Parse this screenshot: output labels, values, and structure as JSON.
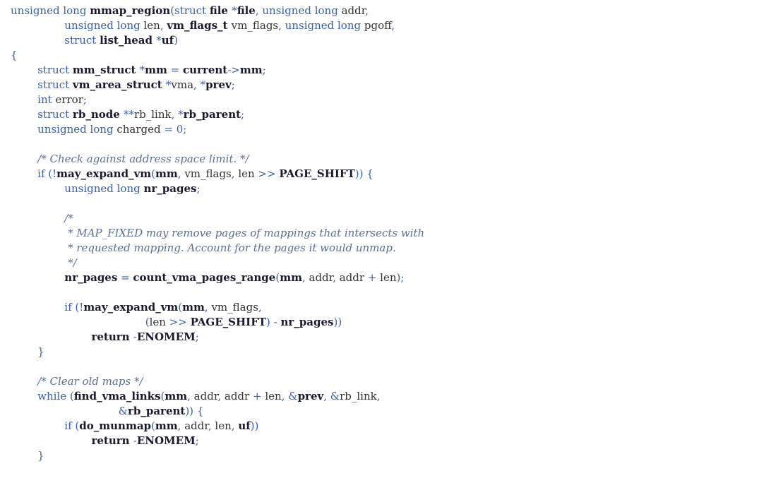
{
  "code": {
    "lines": [
      [
        [
          "kw",
          "unsigned long "
        ],
        [
          "fn",
          "mmap_region"
        ],
        [
          "op",
          "("
        ],
        [
          "kw",
          "struct "
        ],
        [
          "ty",
          "file "
        ],
        [
          "op",
          "*"
        ],
        [
          "fn",
          "file"
        ],
        [
          "op",
          ", "
        ],
        [
          "kw",
          "unsigned long "
        ],
        [
          "pl",
          "addr"
        ],
        [
          "op",
          ","
        ]
      ],
      [
        [
          "pl",
          "                "
        ],
        [
          "kw",
          "unsigned long "
        ],
        [
          "pl",
          "len"
        ],
        [
          "op",
          ", "
        ],
        [
          "ty",
          "vm_flags_t "
        ],
        [
          "pl",
          "vm_flags"
        ],
        [
          "op",
          ", "
        ],
        [
          "kw",
          "unsigned long "
        ],
        [
          "pl",
          "pgoff"
        ],
        [
          "op",
          ","
        ]
      ],
      [
        [
          "pl",
          "                "
        ],
        [
          "kw",
          "struct "
        ],
        [
          "ty",
          "list_head "
        ],
        [
          "op",
          "*"
        ],
        [
          "fn",
          "uf"
        ],
        [
          "op",
          ")"
        ]
      ],
      [
        [
          "op",
          "{"
        ]
      ],
      [
        [
          "pl",
          "        "
        ],
        [
          "kw",
          "struct "
        ],
        [
          "ty",
          "mm_struct "
        ],
        [
          "op",
          "*"
        ],
        [
          "fn",
          "mm"
        ],
        [
          "op",
          " = "
        ],
        [
          "fn",
          "current"
        ],
        [
          "op",
          "->"
        ],
        [
          "fn",
          "mm"
        ],
        [
          "op",
          ";"
        ]
      ],
      [
        [
          "pl",
          "        "
        ],
        [
          "kw",
          "struct "
        ],
        [
          "ty",
          "vm_area_struct "
        ],
        [
          "op",
          "*"
        ],
        [
          "pl",
          "vma"
        ],
        [
          "op",
          ", *"
        ],
        [
          "fn",
          "prev"
        ],
        [
          "op",
          ";"
        ]
      ],
      [
        [
          "pl",
          "        "
        ],
        [
          "kw",
          "int "
        ],
        [
          "pl",
          "error"
        ],
        [
          "op",
          ";"
        ]
      ],
      [
        [
          "pl",
          "        "
        ],
        [
          "kw",
          "struct "
        ],
        [
          "ty",
          "rb_node "
        ],
        [
          "op",
          "**"
        ],
        [
          "pl",
          "rb_link"
        ],
        [
          "op",
          ", *"
        ],
        [
          "fn",
          "rb_parent"
        ],
        [
          "op",
          ";"
        ]
      ],
      [
        [
          "pl",
          "        "
        ],
        [
          "kw",
          "unsigned long "
        ],
        [
          "pl",
          "charged"
        ],
        [
          "op",
          " = "
        ],
        [
          "num",
          "0"
        ],
        [
          "op",
          ";"
        ]
      ],
      [],
      [
        [
          "pl",
          "        "
        ],
        [
          "cm",
          "/* Check against address space limit. */"
        ]
      ],
      [
        [
          "pl",
          "        "
        ],
        [
          "kw",
          "if "
        ],
        [
          "op",
          "(!"
        ],
        [
          "fn",
          "may_expand_vm"
        ],
        [
          "op",
          "("
        ],
        [
          "fn",
          "mm"
        ],
        [
          "op",
          ", "
        ],
        [
          "pl",
          "vm_flags"
        ],
        [
          "op",
          ", "
        ],
        [
          "pl",
          "len "
        ],
        [
          "op",
          ">> "
        ],
        [
          "fn",
          "PAGE_SHIFT"
        ],
        [
          "op",
          "))"
        ],
        [
          "pl",
          " "
        ],
        [
          "op",
          "{"
        ]
      ],
      [
        [
          "pl",
          "                "
        ],
        [
          "kw",
          "unsigned long "
        ],
        [
          "fn",
          "nr_pages"
        ],
        [
          "op",
          ";"
        ]
      ],
      [],
      [
        [
          "pl",
          "                "
        ],
        [
          "cm",
          "/*"
        ]
      ],
      [
        [
          "pl",
          "                 "
        ],
        [
          "cm",
          "* MAP_FIXED may remove pages of mappings that intersects with"
        ]
      ],
      [
        [
          "pl",
          "                 "
        ],
        [
          "cm",
          "* requested mapping. Account for the pages it would unmap."
        ]
      ],
      [
        [
          "pl",
          "                 "
        ],
        [
          "cm",
          "*/"
        ]
      ],
      [
        [
          "pl",
          "                "
        ],
        [
          "fn",
          "nr_pages"
        ],
        [
          "op",
          " = "
        ],
        [
          "fn",
          "count_vma_pages_range"
        ],
        [
          "op",
          "("
        ],
        [
          "fn",
          "mm"
        ],
        [
          "op",
          ", "
        ],
        [
          "pl",
          "addr"
        ],
        [
          "op",
          ", "
        ],
        [
          "pl",
          "addr "
        ],
        [
          "op",
          "+ "
        ],
        [
          "pl",
          "len"
        ],
        [
          "op",
          ");"
        ]
      ],
      [],
      [
        [
          "pl",
          "                "
        ],
        [
          "kw",
          "if "
        ],
        [
          "op",
          "(!"
        ],
        [
          "fn",
          "may_expand_vm"
        ],
        [
          "op",
          "("
        ],
        [
          "fn",
          "mm"
        ],
        [
          "op",
          ", "
        ],
        [
          "pl",
          "vm_flags"
        ],
        [
          "op",
          ","
        ]
      ],
      [
        [
          "pl",
          "                                        "
        ],
        [
          "op",
          "("
        ],
        [
          "pl",
          "len "
        ],
        [
          "op",
          ">> "
        ],
        [
          "fn",
          "PAGE_SHIFT"
        ],
        [
          "op",
          ")"
        ],
        [
          "pl",
          " "
        ],
        [
          "op",
          "- "
        ],
        [
          "fn",
          "nr_pages"
        ],
        [
          "op",
          "))"
        ]
      ],
      [
        [
          "pl",
          "                        "
        ],
        [
          "fn",
          "return "
        ],
        [
          "op",
          "-"
        ],
        [
          "fn",
          "ENOMEM"
        ],
        [
          "op",
          ";"
        ]
      ],
      [
        [
          "pl",
          "        "
        ],
        [
          "op",
          "}"
        ]
      ],
      [],
      [
        [
          "pl",
          "        "
        ],
        [
          "cm",
          "/* Clear old maps */"
        ]
      ],
      [
        [
          "pl",
          "        "
        ],
        [
          "kw",
          "while "
        ],
        [
          "op",
          "("
        ],
        [
          "fn",
          "find_vma_links"
        ],
        [
          "op",
          "("
        ],
        [
          "fn",
          "mm"
        ],
        [
          "op",
          ", "
        ],
        [
          "pl",
          "addr"
        ],
        [
          "op",
          ", "
        ],
        [
          "pl",
          "addr "
        ],
        [
          "op",
          "+ "
        ],
        [
          "pl",
          "len"
        ],
        [
          "op",
          ", &"
        ],
        [
          "fn",
          "prev"
        ],
        [
          "op",
          ", &"
        ],
        [
          "pl",
          "rb_link"
        ],
        [
          "op",
          ","
        ]
      ],
      [
        [
          "pl",
          "                                "
        ],
        [
          "op",
          "&"
        ],
        [
          "fn",
          "rb_parent"
        ],
        [
          "op",
          "))"
        ],
        [
          "pl",
          " "
        ],
        [
          "op",
          "{"
        ]
      ],
      [
        [
          "pl",
          "                "
        ],
        [
          "kw",
          "if "
        ],
        [
          "op",
          "("
        ],
        [
          "fn",
          "do_munmap"
        ],
        [
          "op",
          "("
        ],
        [
          "fn",
          "mm"
        ],
        [
          "op",
          ", "
        ],
        [
          "pl",
          "addr"
        ],
        [
          "op",
          ", "
        ],
        [
          "pl",
          "len"
        ],
        [
          "op",
          ", "
        ],
        [
          "fn",
          "uf"
        ],
        [
          "op",
          "))"
        ]
      ],
      [
        [
          "pl",
          "                        "
        ],
        [
          "fn",
          "return "
        ],
        [
          "op",
          "-"
        ],
        [
          "fn",
          "ENOMEM"
        ],
        [
          "op",
          ";"
        ]
      ],
      [
        [
          "pl",
          "        "
        ],
        [
          "op",
          "}"
        ]
      ]
    ]
  }
}
